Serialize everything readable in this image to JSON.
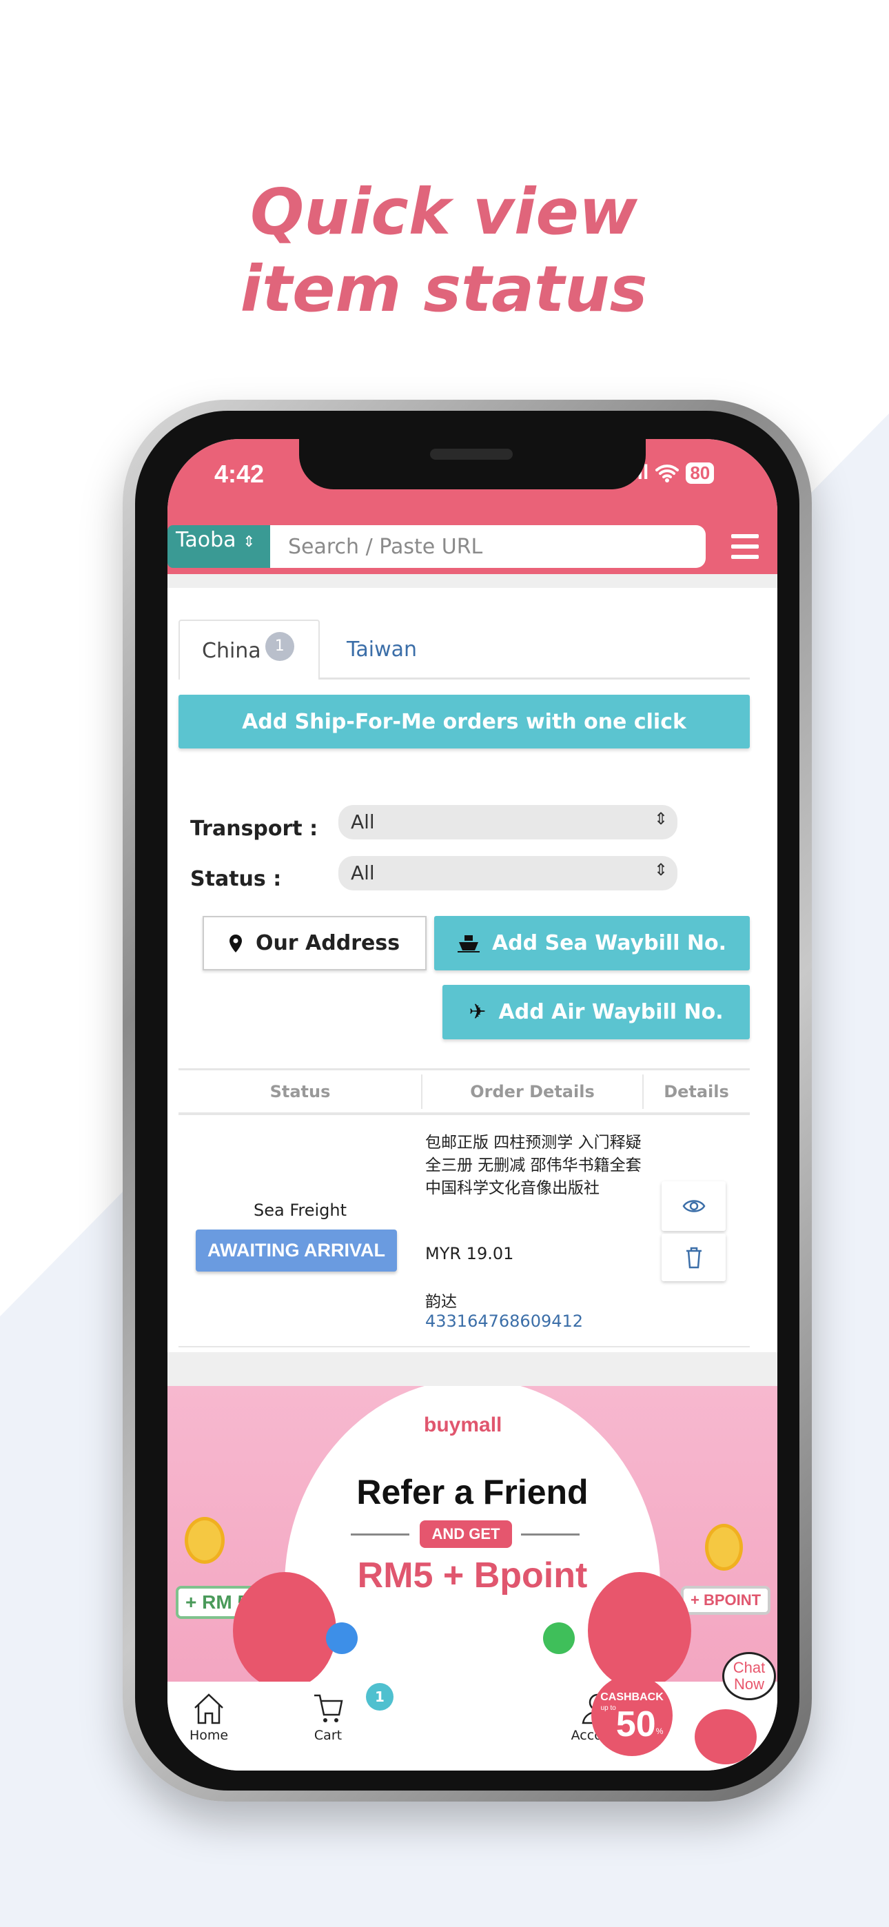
{
  "headline": {
    "line1": "Quick view",
    "line2": "item status"
  },
  "status_bar": {
    "time": "4:42",
    "signal": ".ıll",
    "battery": "80"
  },
  "search": {
    "platform": "Taoba",
    "placeholder": "Search / Paste URL"
  },
  "tabs": [
    {
      "label": "China",
      "badge": "1",
      "active": true
    },
    {
      "label": "Taiwan",
      "active": false
    }
  ],
  "actions": {
    "ship_for_me": "Add Ship-For-Me orders with one click",
    "our_address": "Our Address",
    "sea_waybill": "Add Sea Waybill No.",
    "air_waybill": "Add Air Waybill No."
  },
  "filters": {
    "transport_label": "Transport :",
    "transport_value": "All",
    "status_label": "Status :",
    "status_value": "All"
  },
  "table": {
    "headers": [
      "Status",
      "Order Details",
      "Details"
    ],
    "rows": [
      {
        "transport": "Sea Freight",
        "status": "AWAITING ARRIVAL",
        "title": "包邮正版 四柱预测学 入门释疑全三册 无删减 邵伟华书籍全套 中国科学文化音像出版社",
        "price": "MYR 19.01",
        "courier": "韵达",
        "tracking": "433164768609412"
      }
    ]
  },
  "banner": {
    "logo": "buymall",
    "title": "Refer a Friend",
    "pill": "AND GET",
    "reward": "RM5 + Bpoint",
    "tag_left": "+ RM 5",
    "tag_right": "+ BPOINT"
  },
  "bottom_nav": {
    "home": "Home",
    "cart": "Cart",
    "cart_badge": "1",
    "cashback_label": "CASHBACK",
    "cashback_upto": "up to",
    "cashback_value": "50",
    "cashback_pct": "%",
    "account": "Account",
    "chat": "Chat Now"
  },
  "colors": {
    "brand": "#ea6278",
    "teal": "#5bc4d0",
    "selector": "#3a9a94",
    "status_badge": "#6a9be0",
    "link": "#3b6ea8"
  }
}
